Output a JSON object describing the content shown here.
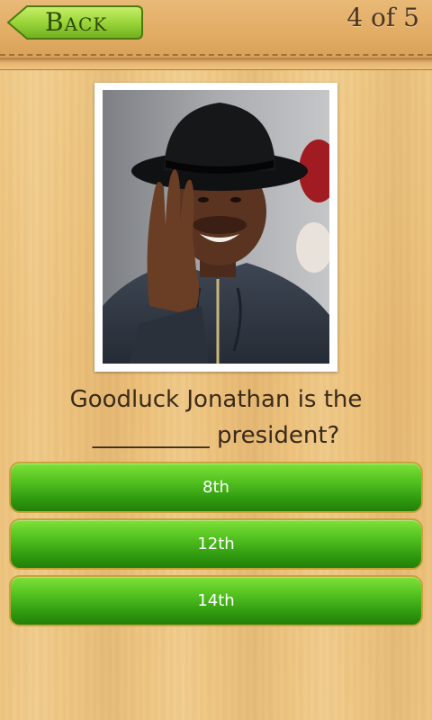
{
  "header": {
    "back_label": "Back",
    "progress": "4 of 5"
  },
  "question": {
    "line1": "Goodluck Jonathan is the",
    "line2": "__________ president?"
  },
  "answers": [
    {
      "label": "8th"
    },
    {
      "label": "12th"
    },
    {
      "label": "14th"
    }
  ],
  "colors": {
    "answer_green": "#3fae18",
    "back_green": "#9ad53a",
    "wood": "#efc784"
  }
}
